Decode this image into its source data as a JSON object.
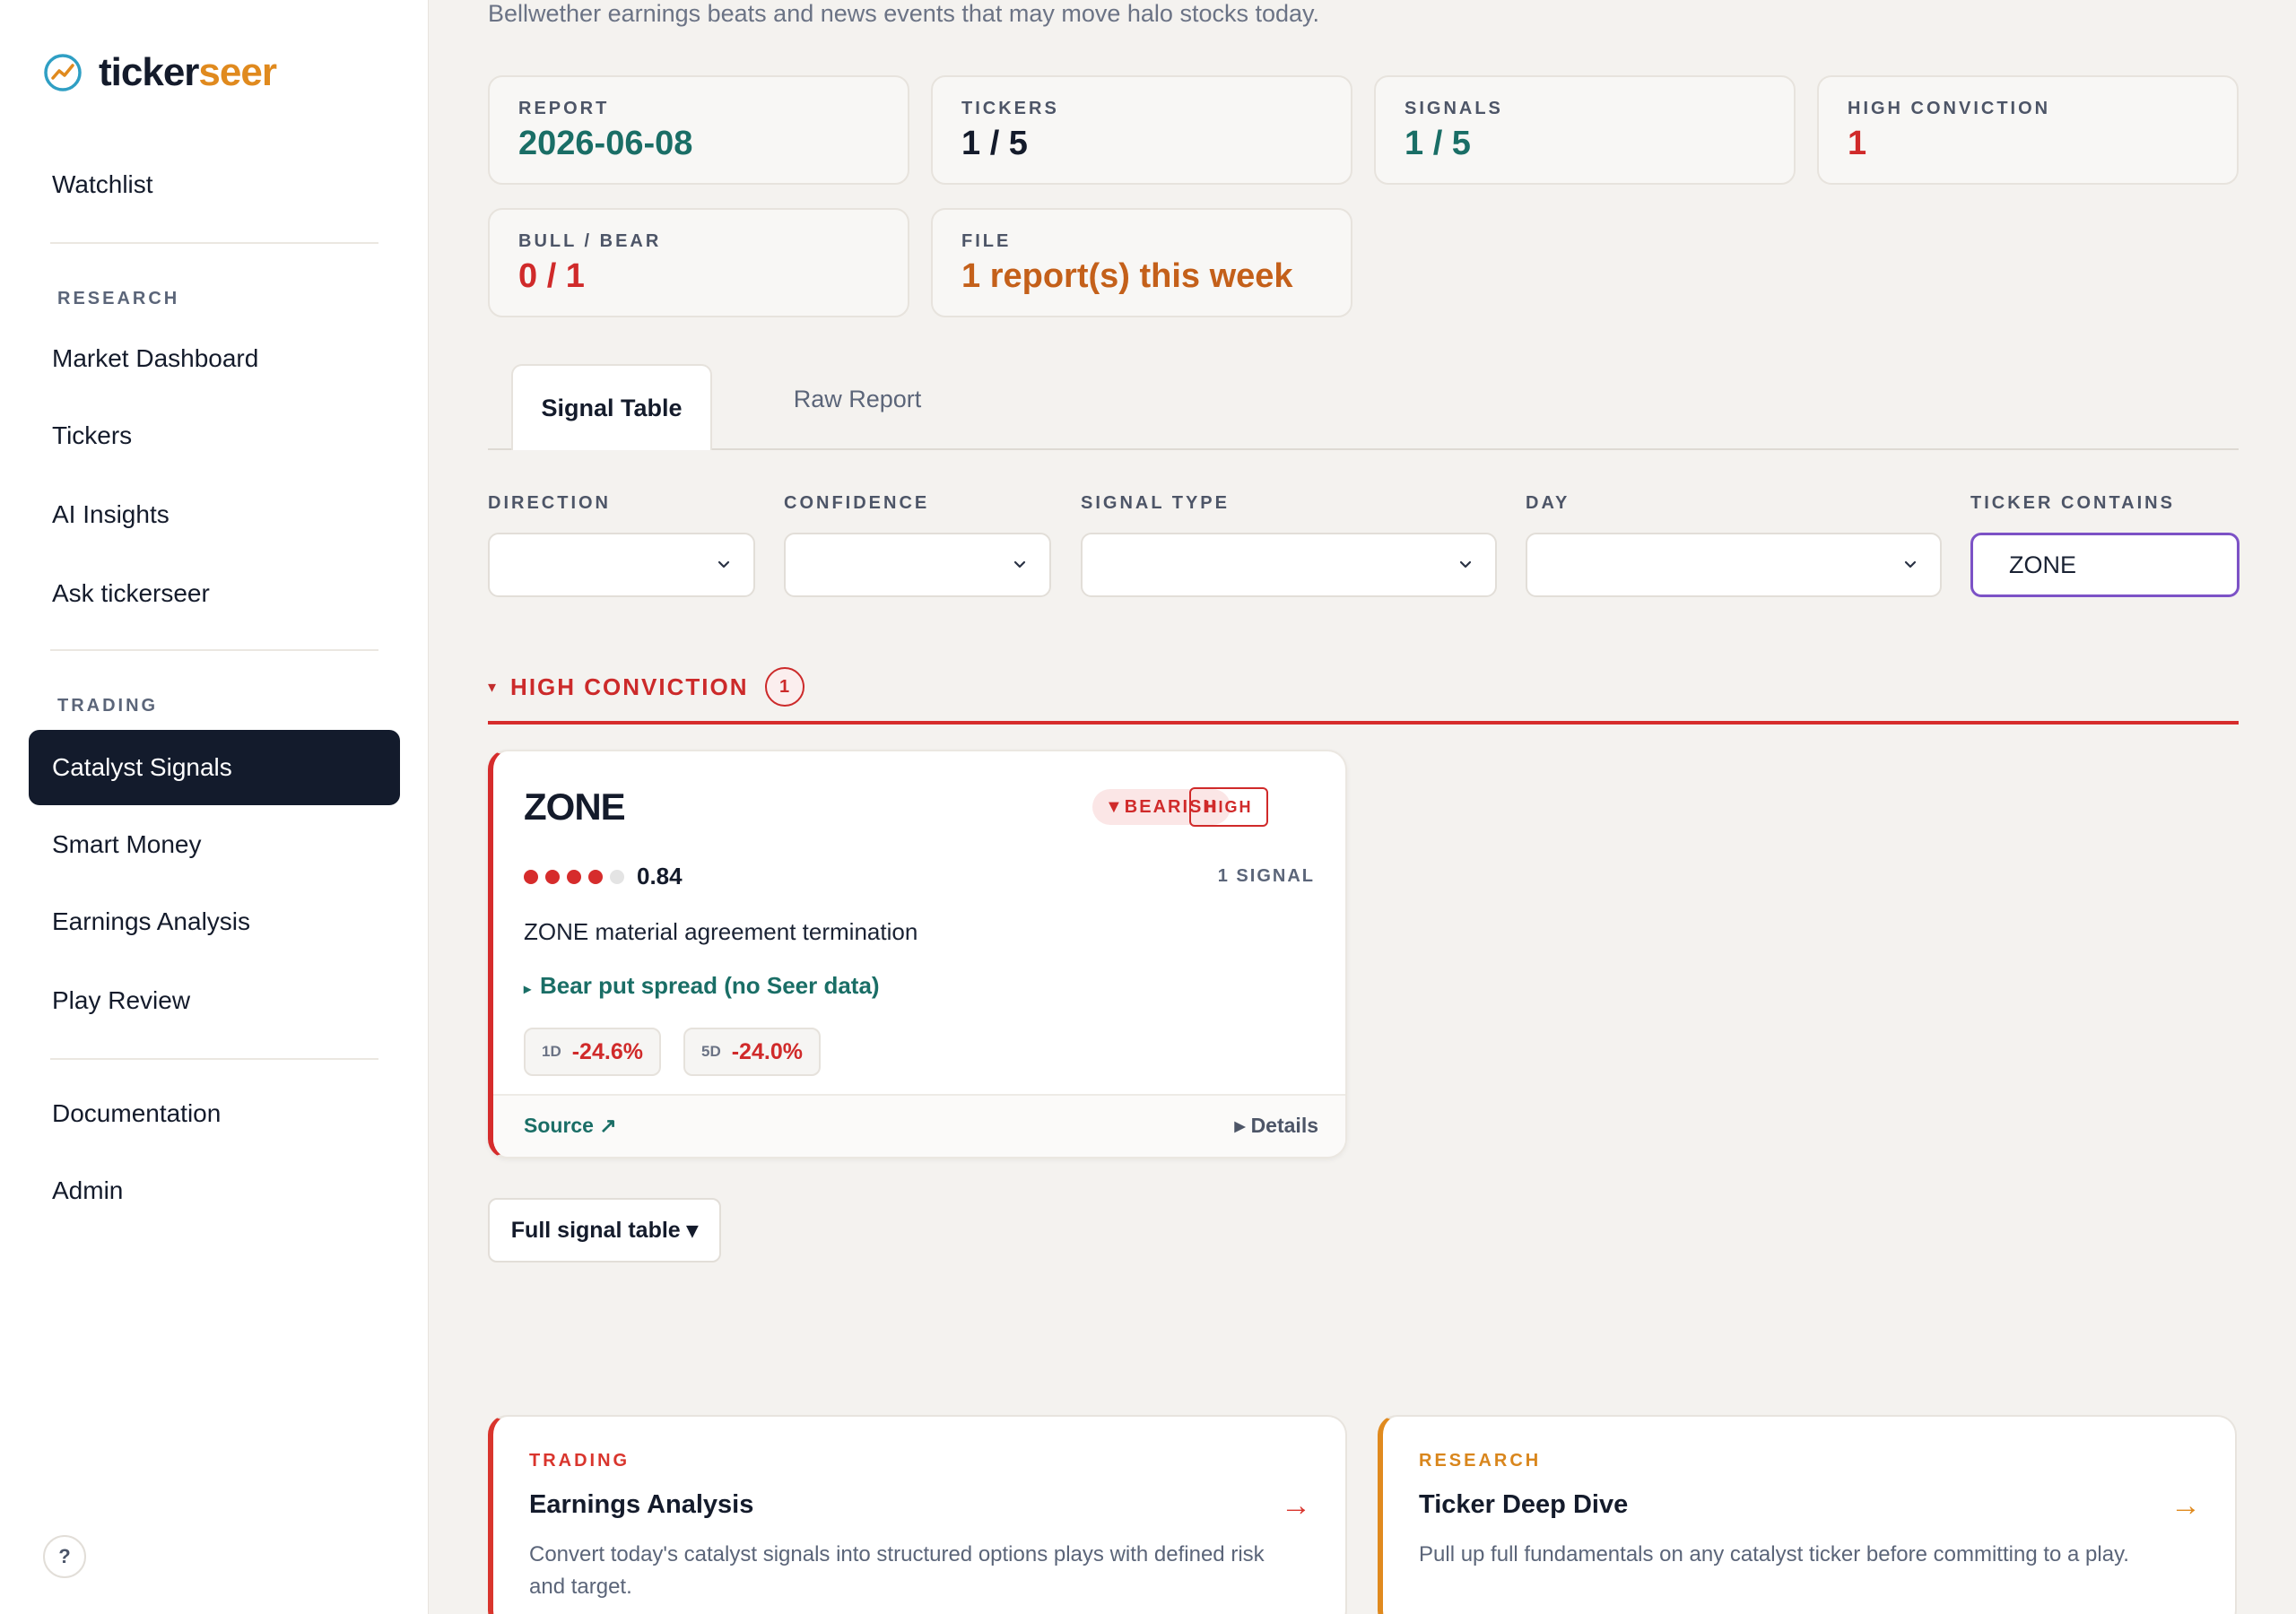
{
  "app": {
    "brand_part1": "ticker",
    "brand_part2": "seer"
  },
  "sidebar": {
    "watchlist": "Watchlist",
    "research_section": "RESEARCH",
    "research_items": [
      "Market Dashboard",
      "Tickers",
      "AI Insights",
      "Ask tickerseer"
    ],
    "trading_section": "TRADING",
    "trading_items": [
      "Catalyst Signals",
      "Smart Money",
      "Earnings Analysis",
      "Play Review"
    ],
    "documentation": "Documentation",
    "admin": "Admin",
    "help": "?"
  },
  "page": {
    "subtitle": "Bellwether earnings beats and news events that may move halo stocks today."
  },
  "stats": {
    "report": {
      "label": "REPORT",
      "value": "2026-06-08"
    },
    "tickers": {
      "label": "TICKERS",
      "value": "1 / 5"
    },
    "signals": {
      "label": "SIGNALS",
      "value": "1 / 5"
    },
    "high_conviction": {
      "label": "HIGH CONVICTION",
      "value": "1"
    },
    "bull_bear": {
      "label": "BULL / BEAR",
      "value": "0 / 1"
    },
    "file": {
      "label": "FILE",
      "value": "1 report(s) this week"
    }
  },
  "tabs": {
    "signal_table": "Signal Table",
    "raw_report": "Raw Report"
  },
  "filters": {
    "direction": {
      "label": "DIRECTION",
      "value": ""
    },
    "confidence": {
      "label": "CONFIDENCE",
      "value": ""
    },
    "signal_type": {
      "label": "SIGNAL TYPE",
      "value": ""
    },
    "day": {
      "label": "DAY",
      "value": ""
    },
    "ticker_contains": {
      "label": "TICKER CONTAINS",
      "value": "ZONE"
    }
  },
  "group": {
    "caret": "▾",
    "title": "HIGH CONVICTION",
    "count": "1"
  },
  "signal": {
    "ticker": "ZONE",
    "direction_badge": "▼BEARISH",
    "conviction_badge": "HIGH",
    "confidence_dots_filled": 4,
    "confidence_dots_total": 5,
    "confidence": "0.84",
    "signal_count": "1 SIGNAL",
    "headline": "ZONE material agreement termination",
    "play_caret": "▸",
    "play": "Bear put spread (no Seer data)",
    "returns": [
      {
        "label": "1D",
        "value": "-24.6%"
      },
      {
        "label": "5D",
        "value": "-24.0%"
      }
    ],
    "source": "Source ↗",
    "details": "▸ Details"
  },
  "full_table_button": "Full signal table ▾",
  "bottom_cards": {
    "trading": {
      "tag": "TRADING",
      "title": "Earnings Analysis",
      "arrow": "→",
      "description": "Convert today's catalyst signals into structured options plays with defined risk and target."
    },
    "research": {
      "tag": "RESEARCH",
      "title": "Ticker Deep Dive",
      "arrow": "→",
      "description": "Pull up full fundamentals on any catalyst ticker before committing to a play."
    }
  },
  "colors": {
    "accent_teal": "#1a6e66",
    "bear_red": "#d02a2a",
    "brand_orange": "#e08a1e",
    "file_orange": "#c4601a",
    "nav_active_bg": "#131b2c",
    "input_focus": "#7c52c6"
  }
}
